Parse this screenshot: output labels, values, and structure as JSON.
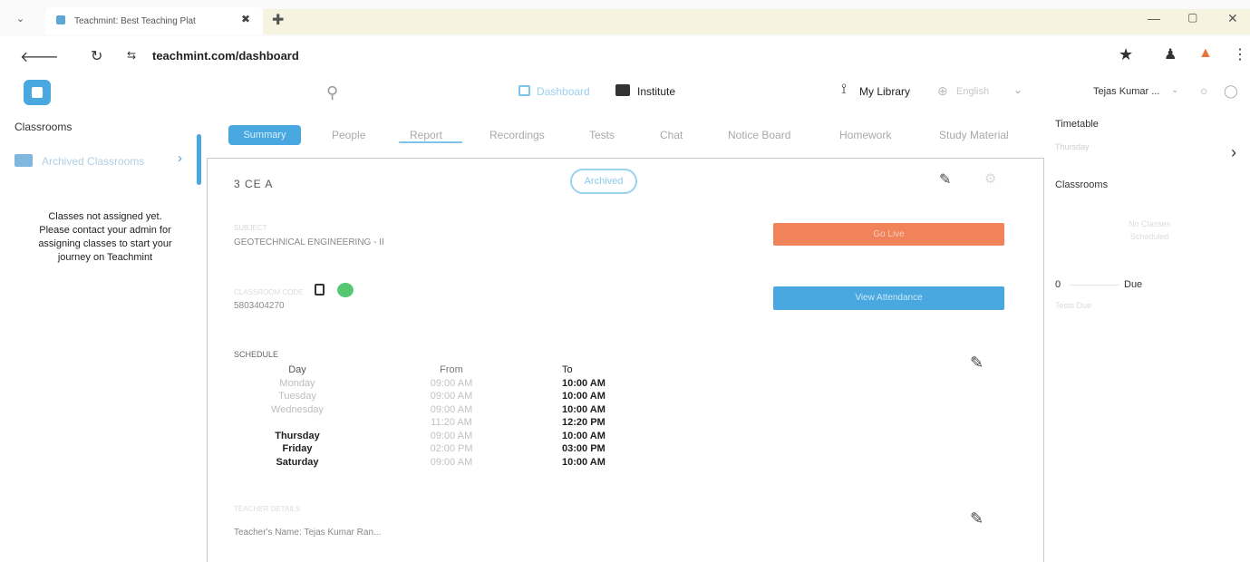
{
  "browser": {
    "tab_title": "Teachmint: Best Teaching Plat",
    "tab_close": "✖",
    "new_tab": "✚",
    "left_control": "⌄",
    "window_min": "—",
    "window_max": "▢",
    "window_close": "✕",
    "back": "🡐",
    "reload": "↻",
    "site_icon": "⇆",
    "url": "teachmint.com/dashboard",
    "star": "★",
    "extensions": "♟",
    "menu": "⋮"
  },
  "header": {
    "search_icon": "⚲",
    "nav": {
      "dashboard": "Dashboard",
      "institute": "Institute"
    },
    "my_library": "My Library",
    "language": "English",
    "user_name": "Tejas Kumar ...",
    "chevron": "⌄"
  },
  "left_panel": {
    "title": "Classrooms",
    "archived_item": "Archived Classrooms",
    "chevron": "›",
    "notice_lines": [
      "Classes not assigned yet.",
      "Please contact your admin for",
      "assigning classes to start your",
      "journey on Teachmint"
    ]
  },
  "tabs": [
    {
      "label": "Summary",
      "active": true
    },
    {
      "label": "People"
    },
    {
      "label": "Report"
    },
    {
      "label": "Recordings"
    },
    {
      "label": "Tests"
    },
    {
      "label": "Chat"
    },
    {
      "label": "Notice Board"
    },
    {
      "label": "Homework"
    },
    {
      "label": "Study Material"
    }
  ],
  "classroom": {
    "name": "3 CE A",
    "status_badge": "Archived",
    "subject_label": "SUBJECT",
    "subject": "GEOTECHNICAL ENGINEERING - II",
    "go_live": "Go Live",
    "class_code_label": "CLASSROOM CODE",
    "class_code": "5803404270",
    "view_pin_label": "View Attendance",
    "schedule_label": "SCHEDULE",
    "schedule_headers": {
      "day": "Day",
      "from": "From",
      "to": "To"
    },
    "schedule": [
      {
        "day": "Monday",
        "from": "09:00 AM",
        "to": "10:00 AM",
        "faint": true
      },
      {
        "day": "Tuesday",
        "from": "09:00 AM",
        "to": "10:00 AM",
        "faint": true
      },
      {
        "day": "Wednesday",
        "from": "09:00 AM",
        "to": "10:00 AM",
        "faint": true
      },
      {
        "day": "",
        "from": "11:20 AM",
        "to": "12:20 PM",
        "faint": true
      },
      {
        "day": "Thursday",
        "from": "09:00 AM",
        "to": "10:00 AM",
        "faint": false
      },
      {
        "day": "Friday",
        "from": "02:00 PM",
        "to": "03:00 PM",
        "faint": false
      },
      {
        "day": "Saturday",
        "from": "09:00 AM",
        "to": "10:00 AM",
        "faint": false
      }
    ],
    "teachers_label": "TEACHER DETAILS",
    "teachers": "Teacher's Name: Tejas Kumar Ran..."
  },
  "right_panel": {
    "timetable_title": "Timetable",
    "timetable_day": "Thursday",
    "chevron": "›",
    "classrooms_title": "Classrooms",
    "no_classes": "No Classes Scheduled",
    "due_count": "0",
    "due_label": "Due",
    "due_sub": "Tests Due"
  },
  "icons": {
    "edit": "✎",
    "share": "⚙",
    "library": "⟟",
    "lang": "⊕",
    "bell": "○",
    "help": "◯"
  },
  "colors": {
    "primary": "#4aa8e0",
    "go_live": "#f08359",
    "whatsapp": "#57c774"
  }
}
